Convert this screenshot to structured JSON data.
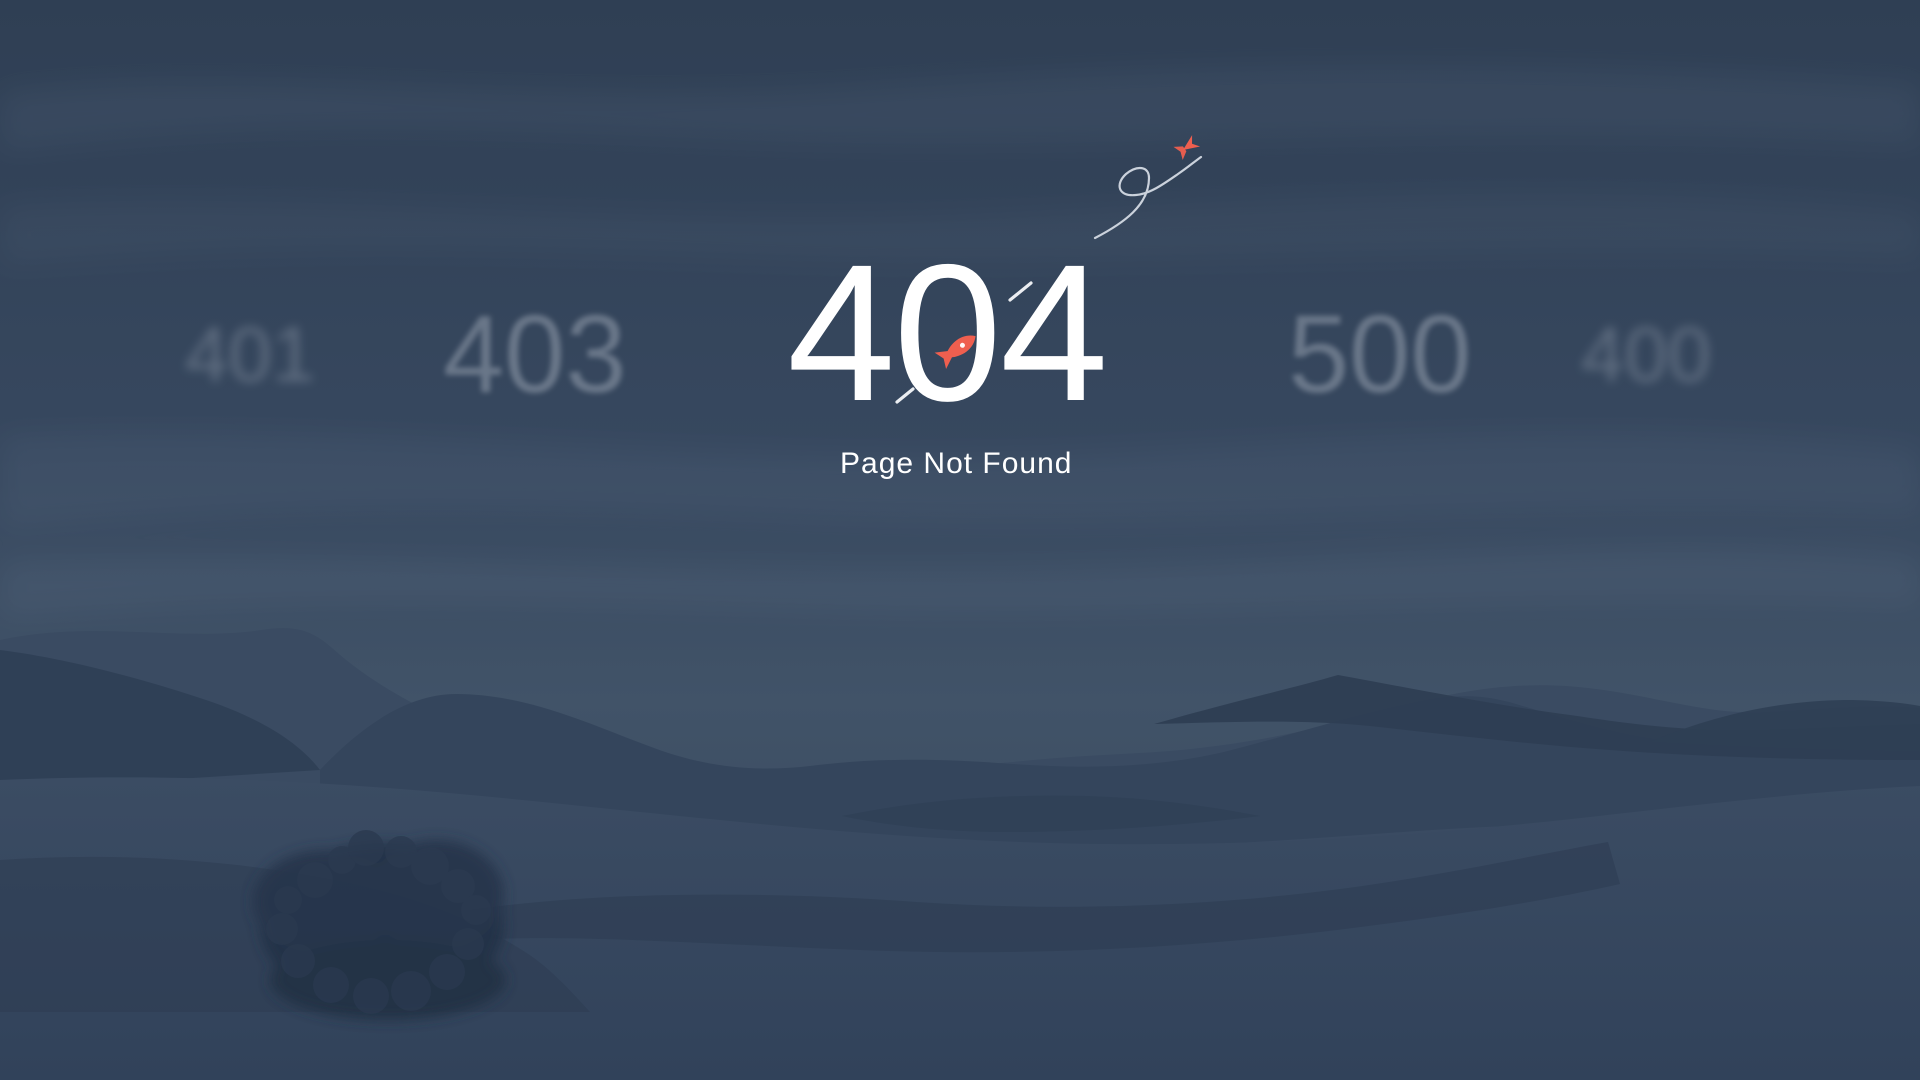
{
  "error_code": "404",
  "message": "Page Not Found",
  "background_codes": {
    "far_left": "401",
    "left": "403",
    "right": "500",
    "far_right": "400"
  },
  "icons": {
    "rocket": "rocket-icon",
    "trail": "flight-trail-icon"
  },
  "colors": {
    "background": "#33435a",
    "text": "#ffffff",
    "accent": "#ef5f4f"
  }
}
